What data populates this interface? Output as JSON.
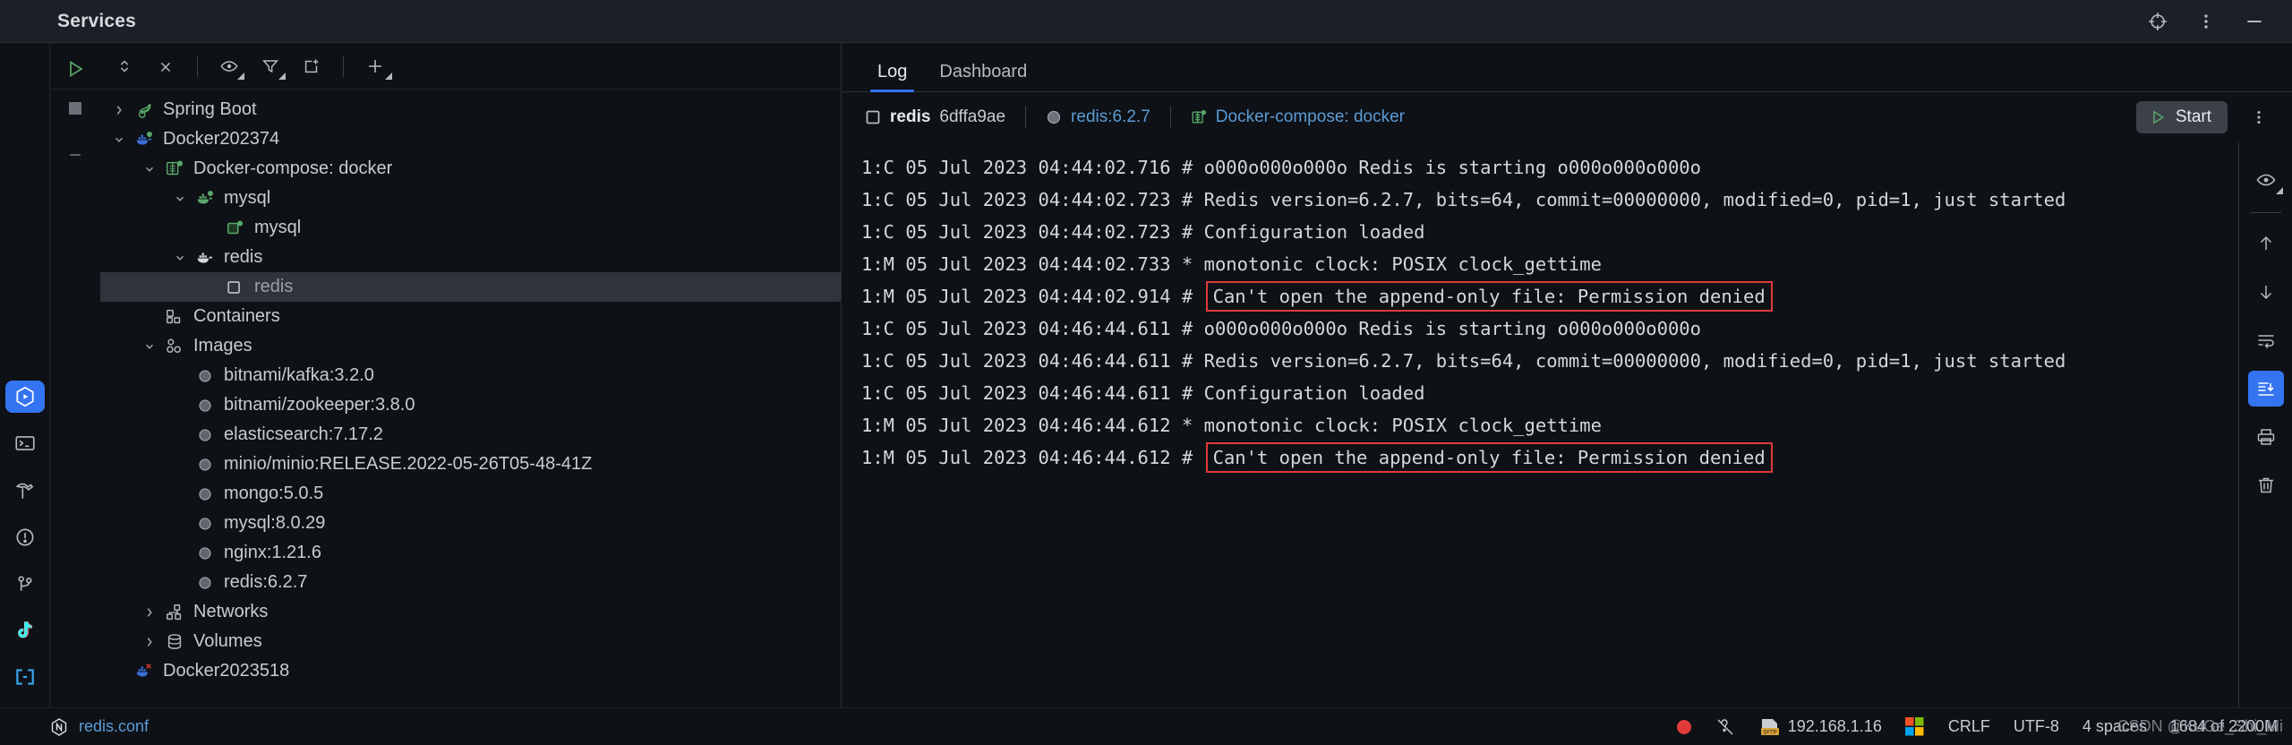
{
  "window": {
    "title": "Services",
    "controls": [
      {
        "name": "target-icon",
        "glyph": "target"
      },
      {
        "name": "more-vertical-icon",
        "glyph": "kebab"
      },
      {
        "name": "minimize-icon",
        "glyph": "minus"
      }
    ]
  },
  "tree_toolbar": {
    "run_label": "Run",
    "stop_label": "Stop",
    "items": [
      {
        "name": "expand-collapse-icon",
        "label": "Expand / Collapse"
      },
      {
        "name": "close-icon",
        "label": "Close"
      },
      {
        "name": "eye-icon",
        "label": "Show"
      },
      {
        "name": "filter-icon",
        "label": "Filter"
      },
      {
        "name": "new-tab-icon",
        "label": "Add Tab"
      },
      {
        "name": "plus-icon",
        "label": "Add Service"
      }
    ]
  },
  "tree": {
    "nodes": [
      {
        "id": "spring-boot",
        "label": "Spring Boot",
        "indent": 0,
        "twisty": "right",
        "icon": "spring-leaf-icon",
        "selected": false
      },
      {
        "id": "docker202374",
        "label": "Docker202374",
        "indent": 0,
        "twisty": "down",
        "icon": "docker-whale-icon",
        "selected": false
      },
      {
        "id": "docker-compose",
        "label": "Docker-compose: docker",
        "indent": 1,
        "twisty": "down",
        "icon": "compose-grid-icon",
        "selected": false
      },
      {
        "id": "mysql-service",
        "label": "mysql",
        "indent": 2,
        "twisty": "down",
        "icon": "docker-whale-green-icon",
        "selected": false
      },
      {
        "id": "mysql-container",
        "label": "mysql",
        "indent": 3,
        "twisty": "none",
        "icon": "container-green-icon",
        "selected": false
      },
      {
        "id": "redis-service",
        "label": "redis",
        "indent": 2,
        "twisty": "down",
        "icon": "docker-whale-grey-icon",
        "selected": false
      },
      {
        "id": "redis-container",
        "label": "redis",
        "indent": 3,
        "twisty": "none",
        "icon": "container-stopped-icon",
        "selected": true
      },
      {
        "id": "containers",
        "label": "Containers",
        "indent": 1,
        "twisty": "none",
        "icon": "containers-icon",
        "selected": false
      },
      {
        "id": "images",
        "label": "Images",
        "indent": 1,
        "twisty": "down",
        "icon": "images-icon",
        "selected": false
      },
      {
        "id": "img-kafka",
        "label": "bitnami/kafka:3.2.0",
        "indent": 2,
        "twisty": "none",
        "icon": "image-circle-icon",
        "selected": false
      },
      {
        "id": "img-zookeeper",
        "label": "bitnami/zookeeper:3.8.0",
        "indent": 2,
        "twisty": "none",
        "icon": "image-circle-icon",
        "selected": false
      },
      {
        "id": "img-elasticsearch",
        "label": "elasticsearch:7.17.2",
        "indent": 2,
        "twisty": "none",
        "icon": "image-circle-icon",
        "selected": false
      },
      {
        "id": "img-minio",
        "label": "minio/minio:RELEASE.2022-05-26T05-48-41Z",
        "indent": 2,
        "twisty": "none",
        "icon": "image-circle-icon",
        "selected": false
      },
      {
        "id": "img-mongo",
        "label": "mongo:5.0.5",
        "indent": 2,
        "twisty": "none",
        "icon": "image-circle-icon",
        "selected": false
      },
      {
        "id": "img-mysql",
        "label": "mysql:8.0.29",
        "indent": 2,
        "twisty": "none",
        "icon": "image-circle-icon",
        "selected": false
      },
      {
        "id": "img-nginx",
        "label": "nginx:1.21.6",
        "indent": 2,
        "twisty": "none",
        "icon": "image-circle-icon",
        "selected": false
      },
      {
        "id": "img-redis",
        "label": "redis:6.2.7",
        "indent": 2,
        "twisty": "none",
        "icon": "image-circle-icon",
        "selected": false
      },
      {
        "id": "networks",
        "label": "Networks",
        "indent": 1,
        "twisty": "right",
        "icon": "networks-icon",
        "selected": false
      },
      {
        "id": "volumes",
        "label": "Volumes",
        "indent": 1,
        "twisty": "right",
        "icon": "volumes-icon",
        "selected": false
      },
      {
        "id": "docker2023518",
        "label": "Docker2023518",
        "indent": 0,
        "twisty": "none",
        "icon": "docker-whale-error-icon",
        "selected": false
      }
    ]
  },
  "log_panel": {
    "tabs": [
      {
        "id": "log",
        "label": "Log",
        "active": true
      },
      {
        "id": "dashboard",
        "label": "Dashboard",
        "active": false
      }
    ],
    "breadcrumb": {
      "container_name": "redis",
      "container_id": "6dffa9ae",
      "image": "redis:6.2.7",
      "compose": "Docker-compose: docker"
    },
    "start_label": "Start",
    "side_tools": [
      {
        "name": "eye-icon",
        "label": "Configure log views",
        "active": false
      },
      {
        "name": "arrow-up-icon",
        "label": "Previous occurrence",
        "active": false
      },
      {
        "name": "arrow-down-icon",
        "label": "Next occurrence",
        "active": false
      },
      {
        "name": "soft-wrap-icon",
        "label": "Soft-Wrap",
        "active": false
      },
      {
        "name": "scroll-to-end-icon",
        "label": "Scroll to the end",
        "active": true
      },
      {
        "name": "print-icon",
        "label": "Print",
        "active": false
      },
      {
        "name": "trash-icon",
        "label": "Clear All",
        "active": false
      }
    ],
    "lines": [
      {
        "text": "1:C 05 Jul 2023 04:44:02.716 # o000o000o000o Redis is starting o000o000o000o",
        "highlight": null
      },
      {
        "text": "1:C 05 Jul 2023 04:44:02.723 # Redis version=6.2.7, bits=64, commit=00000000, modified=0, pid=1, just started",
        "highlight": null
      },
      {
        "text": "1:C 05 Jul 2023 04:44:02.723 # Configuration loaded",
        "highlight": null
      },
      {
        "text": "1:M 05 Jul 2023 04:44:02.733 * monotonic clock: POSIX clock_gettime",
        "highlight": null
      },
      {
        "text": "1:M 05 Jul 2023 04:44:02.914 # ",
        "highlight": "Can't open the append-only file: Permission denied"
      },
      {
        "text": "1:C 05 Jul 2023 04:46:44.611 # o000o000o000o Redis is starting o000o000o000o",
        "highlight": null
      },
      {
        "text": "1:C 05 Jul 2023 04:46:44.611 # Redis version=6.2.7, bits=64, commit=00000000, modified=0, pid=1, just started",
        "highlight": null
      },
      {
        "text": "1:C 05 Jul 2023 04:46:44.611 # Configuration loaded",
        "highlight": null
      },
      {
        "text": "1:M 05 Jul 2023 04:46:44.612 * monotonic clock: POSIX clock_gettime",
        "highlight": null
      },
      {
        "text": "1:M 05 Jul 2023 04:46:44.612 # ",
        "highlight": "Can't open the append-only file: Permission denied"
      }
    ]
  },
  "statusbar": {
    "file_label": "redis.conf",
    "sftp_host": "192.168.1.16",
    "line_separator": "CRLF",
    "encoding": "UTF-8",
    "indent": "4 spaces",
    "memory": "1684 of 2200M",
    "watermark": "CSDN @KuGe_Shi_Mi"
  },
  "colors": {
    "accent": "#3574f0",
    "error_border": "#e03a3a",
    "link": "#5b9bd5",
    "run_green": "#59a869",
    "panel_bg": "#0e1116",
    "titlebar_bg": "#1b1f26",
    "selection_bg": "#2f333b"
  }
}
